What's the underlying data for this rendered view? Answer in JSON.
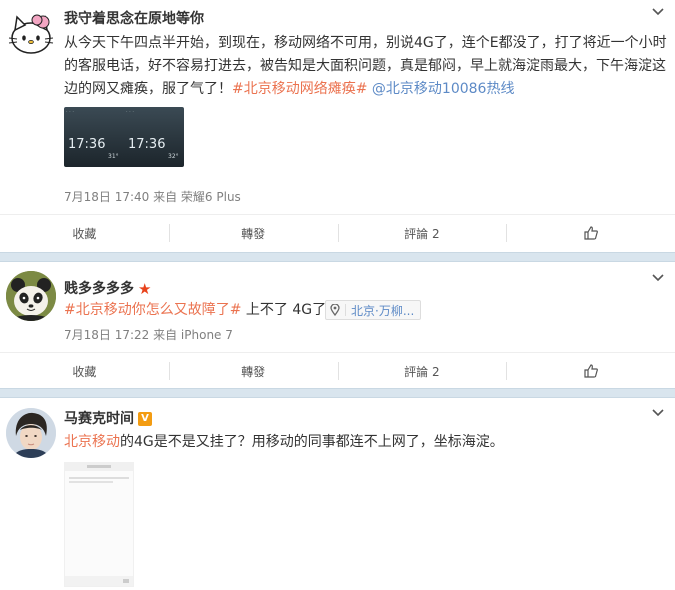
{
  "posts": [
    {
      "author": "我守着思念在原地等你",
      "text": {
        "p1": "从今天下午四点半开始，到现在，移动网络不可用，别说4G了，连个E都没了，打了将近一个小时的客服电话，好不容易打进去，被告知是大面积问题，真是郁闷，早上就海淀雨最大，下午海淀这边的网又瘫痪，服了气了！",
        "tag": "#北京移动网络瘫痪#",
        "mention": "@北京移动10086热线"
      },
      "image_times": [
        "17:36",
        "17:36"
      ],
      "image_temps": [
        "31°",
        "32°"
      ],
      "meta": "7月18日 17:40 来自 荣耀6 Plus",
      "actions": {
        "fav": "收藏",
        "repost": "轉發",
        "comment": "評論 2"
      }
    },
    {
      "author": "贱多多多多",
      "text": {
        "tag": "#北京移动你怎么又故障了#",
        "tail": " 上不了 4G了"
      },
      "location": "北京·万柳...",
      "meta": "7月18日 17:22 来自 iPhone 7",
      "actions": {
        "fav": "收藏",
        "repost": "轉發",
        "comment": "評論 2"
      }
    },
    {
      "author": "马赛克时间",
      "verified": "V",
      "text": {
        "tag": "北京移动",
        "tail": "的4G是不是又挂了？用移动的同事都连不上网了，坐标海淀。"
      }
    }
  ],
  "colors": {
    "tag": "#eb7350",
    "link": "#5d8ac6",
    "separator": "#d9e5ee",
    "verified": "#f39c12"
  }
}
